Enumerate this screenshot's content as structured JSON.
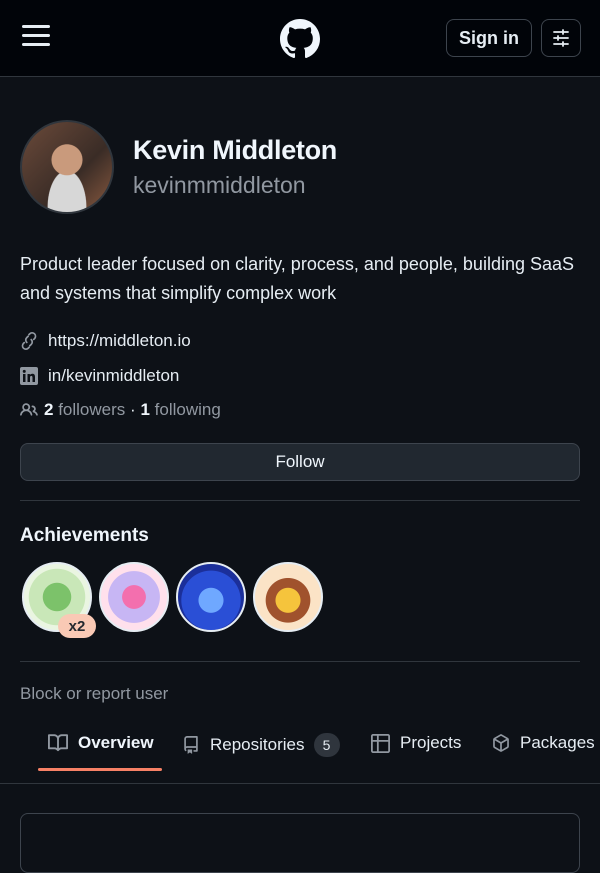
{
  "header": {
    "signin_label": "Sign in"
  },
  "profile": {
    "full_name": "Kevin Middleton",
    "username": "kevinmmiddleton",
    "bio": "Product leader focused on clarity, process, and people, building SaaS and systems that simplify complex work",
    "website": "https://middleton.io",
    "linkedin": "in/kevinmiddleton",
    "followers_count": "2",
    "followers_label": "followers",
    "separator": "·",
    "following_count": "1",
    "following_label": "following",
    "follow_button": "Follow"
  },
  "achievements": {
    "title": "Achievements",
    "badges": [
      {
        "name": "pair-extraordinaire",
        "count": "x2"
      },
      {
        "name": "yolo"
      },
      {
        "name": "pull-shark"
      },
      {
        "name": "starstruck"
      }
    ]
  },
  "block_report": "Block or report user",
  "tabs": [
    {
      "label": "Overview",
      "active": true
    },
    {
      "label": "Repositories",
      "counter": "5"
    },
    {
      "label": "Projects"
    },
    {
      "label": "Packages"
    }
  ],
  "colors": {
    "background": "#0d1117",
    "header": "#010409",
    "accent_underline": "#f78166",
    "muted_text": "#9198a1"
  },
  "icons": [
    "menu-icon",
    "github-logo-icon",
    "sliders-icon",
    "link-icon",
    "linkedin-icon",
    "people-icon",
    "book-icon",
    "repo-icon",
    "table-icon",
    "package-icon"
  ]
}
